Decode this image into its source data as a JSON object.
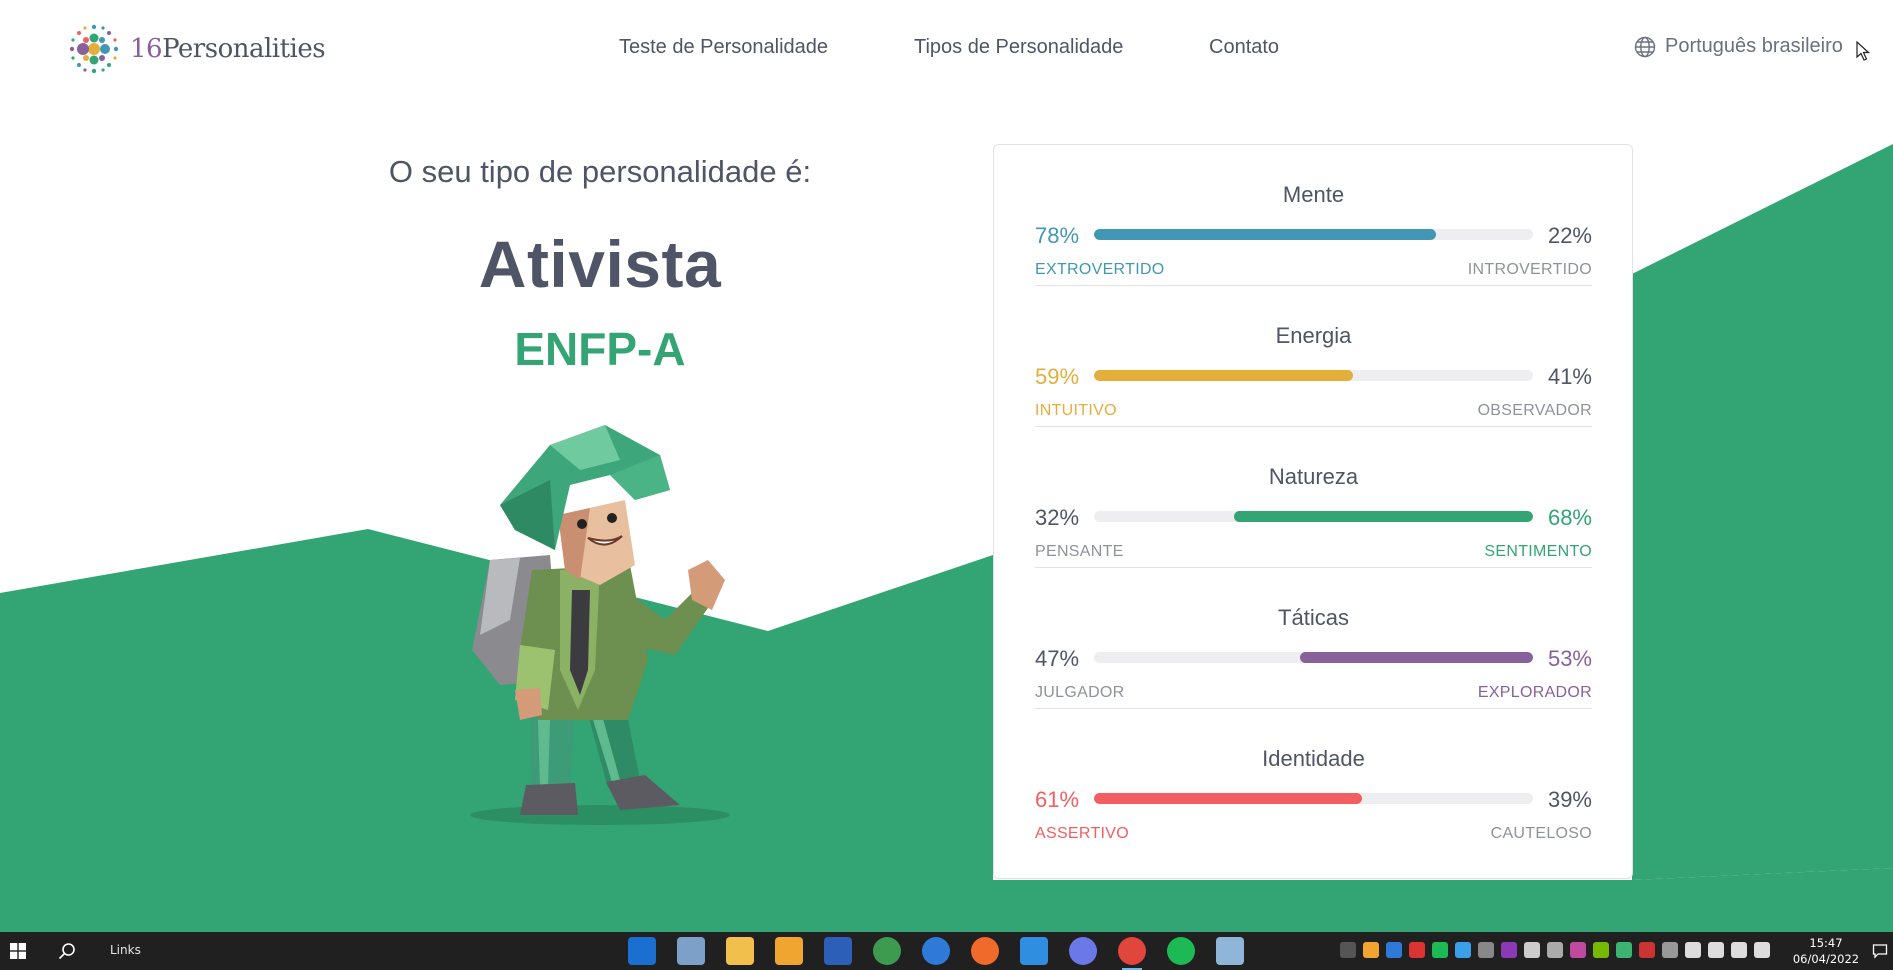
{
  "header": {
    "logo_number": "16",
    "logo_word": "Personalities",
    "nav": [
      "Teste de Personalidade",
      "Tipos de Personalidade",
      "Contato"
    ],
    "language": "Português brasileiro"
  },
  "result": {
    "intro": "O seu tipo de personalidade é:",
    "type_name": "Ativista",
    "type_code": "ENFP-A"
  },
  "traits": [
    {
      "title": "Mente",
      "left_pct": "78%",
      "right_pct": "22%",
      "left_label": "EXTROVERTIDO",
      "right_label": "INTROVERTIDO",
      "dominant": "left",
      "value": 78,
      "color": "#4298b4"
    },
    {
      "title": "Energia",
      "left_pct": "59%",
      "right_pct": "41%",
      "left_label": "INTUITIVO",
      "right_label": "OBSERVADOR",
      "dominant": "left",
      "value": 59,
      "color": "#e4ae3a"
    },
    {
      "title": "Natureza",
      "left_pct": "32%",
      "right_pct": "68%",
      "left_label": "PENSANTE",
      "right_label": "SENTIMENTO",
      "dominant": "right",
      "value": 68,
      "color": "#33a474"
    },
    {
      "title": "Táticas",
      "left_pct": "47%",
      "right_pct": "53%",
      "left_label": "JULGADOR",
      "right_label": "EXPLORADOR",
      "dominant": "right",
      "value": 53,
      "color": "#88619a"
    },
    {
      "title": "Identidade",
      "left_pct": "61%",
      "right_pct": "39%",
      "left_label": "ASSERTIVO",
      "right_label": "CAUTELOSO",
      "dominant": "left",
      "value": 61,
      "color": "#f25e62"
    }
  ],
  "colors": {
    "brand_green": "#33a474",
    "text_dark": "#4f5566",
    "muted": "#8e929b",
    "taskbar": "#202020"
  },
  "taskbar": {
    "links_label": "Links",
    "apps": [
      "calendar-app-icon",
      "snipping-tool-icon",
      "file-explorer-icon",
      "outlook-icon",
      "word-icon",
      "hubstaff-icon",
      "thunderbird-icon",
      "firefox-icon",
      "vscode-icon",
      "discord-icon",
      "chrome-icon",
      "spotify-icon",
      "notepad-icon"
    ],
    "time": "15:47",
    "date": "06/04/2022"
  }
}
